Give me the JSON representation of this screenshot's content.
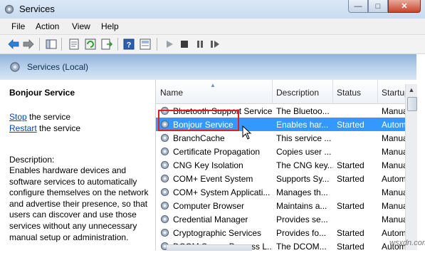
{
  "window": {
    "title": "Services"
  },
  "menu": [
    "File",
    "Action",
    "View",
    "Help"
  ],
  "header": {
    "title": "Services (Local)"
  },
  "details": {
    "service_name": "Bonjour Service",
    "stop_link": "Stop",
    "stop_rest": " the service",
    "restart_link": "Restart",
    "restart_rest": " the service",
    "description_label": "Description:",
    "description": "Enables hardware devices and software services to automatically configure themselves on the network and advertise their presence, so that users can discover and use those services without any unnecessary manual setup or administration."
  },
  "columns": [
    "Name",
    "Description",
    "Status",
    "Startup"
  ],
  "rows": [
    {
      "name": "Bluetooth Support Service",
      "description": "The Bluetoo...",
      "status": "",
      "startup": "Manua"
    },
    {
      "name": "Bonjour Service",
      "description": "Enables har...",
      "status": "Started",
      "startup": "Autom",
      "selected": true
    },
    {
      "name": "BranchCache",
      "description": "This service ...",
      "status": "",
      "startup": "Manua"
    },
    {
      "name": "Certificate Propagation",
      "description": "Copies user ...",
      "status": "",
      "startup": "Manua"
    },
    {
      "name": "CNG Key Isolation",
      "description": "The CNG key...",
      "status": "Started",
      "startup": "Manua"
    },
    {
      "name": "COM+ Event System",
      "description": "Supports Sy...",
      "status": "Started",
      "startup": "Autom"
    },
    {
      "name": "COM+ System Applicati...",
      "description": "Manages th...",
      "status": "",
      "startup": "Manua"
    },
    {
      "name": "Computer Browser",
      "description": "Maintains a...",
      "status": "Started",
      "startup": "Manua"
    },
    {
      "name": "Credential Manager",
      "description": "Provides se...",
      "status": "",
      "startup": "Manua"
    },
    {
      "name": "Cryptographic Services",
      "description": "Provides fo...",
      "status": "Started",
      "startup": "Autom"
    },
    {
      "name": "DCOM Server Process L...",
      "description": "The DCOM...",
      "status": "Started",
      "startup": "Autom"
    }
  ],
  "watermark": "wsxdn.com",
  "colors": {
    "selection": "#3399ff",
    "highlight_box": "#e01f25",
    "link": "#0645ad"
  }
}
